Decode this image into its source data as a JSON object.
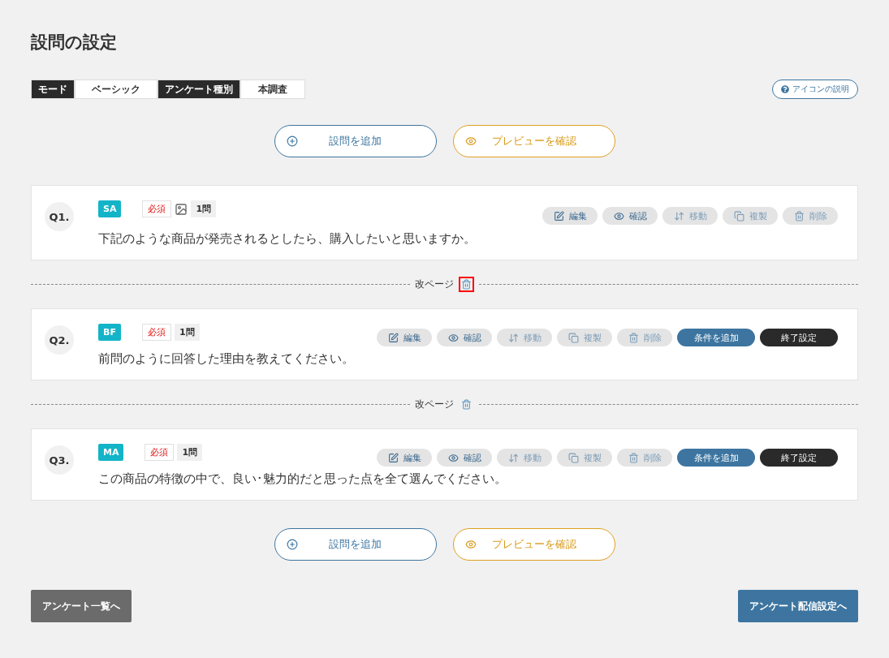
{
  "title": "設問の設定",
  "settings": [
    {
      "label": "モード",
      "value": "ベーシック"
    },
    {
      "label": "アンケート種別",
      "value": "本調査"
    }
  ],
  "help_button": "アイコンの説明",
  "top_actions": [
    {
      "kind": "add",
      "label": "設問を追加"
    },
    {
      "kind": "preview",
      "label": "プレビューを確認"
    }
  ],
  "items": [
    {
      "kind": "question",
      "number": "Q1.",
      "type": "SA",
      "required": "必須",
      "has_image": true,
      "count": "1問",
      "text": "下記のような商品が発売されるとしたら、購入したいと思いますか。",
      "actions": [
        {
          "kind": "edit",
          "label": "編集",
          "disabled": false
        },
        {
          "kind": "view",
          "label": "確認",
          "disabled": false
        },
        {
          "kind": "move",
          "label": "移動",
          "disabled": true
        },
        {
          "kind": "copy",
          "label": "複製",
          "disabled": true
        },
        {
          "kind": "delete",
          "label": "削除",
          "disabled": true
        }
      ]
    },
    {
      "kind": "page_break",
      "label": "改ページ",
      "highlighted": true
    },
    {
      "kind": "question",
      "number": "Q2.",
      "type": "BF",
      "required": "必須",
      "has_image": false,
      "count": "1問",
      "text": "前問のように回答した理由を教えてください。",
      "actions": [
        {
          "kind": "edit",
          "label": "編集",
          "disabled": false
        },
        {
          "kind": "view",
          "label": "確認",
          "disabled": false
        },
        {
          "kind": "move",
          "label": "移動",
          "disabled": true
        },
        {
          "kind": "copy",
          "label": "複製",
          "disabled": true
        },
        {
          "kind": "delete",
          "label": "削除",
          "disabled": true
        },
        {
          "kind": "condition",
          "label": "条件を追加",
          "disabled": false
        },
        {
          "kind": "end",
          "label": "終了設定",
          "disabled": false
        }
      ]
    },
    {
      "kind": "page_break",
      "label": "改ページ",
      "highlighted": false
    },
    {
      "kind": "question",
      "number": "Q3.",
      "type": "MA",
      "required": "必須",
      "has_image": false,
      "count": "1問",
      "text": "この商品の特徴の中で、良い･魅力的だと思った点を全て選んでください。",
      "actions": [
        {
          "kind": "edit",
          "label": "編集",
          "disabled": false
        },
        {
          "kind": "view",
          "label": "確認",
          "disabled": false
        },
        {
          "kind": "move",
          "label": "移動",
          "disabled": true
        },
        {
          "kind": "copy",
          "label": "複製",
          "disabled": true
        },
        {
          "kind": "delete",
          "label": "削除",
          "disabled": true
        },
        {
          "kind": "condition",
          "label": "条件を追加",
          "disabled": false
        },
        {
          "kind": "end",
          "label": "終了設定",
          "disabled": false
        }
      ]
    }
  ],
  "bottom_actions": [
    {
      "kind": "add",
      "label": "設問を追加"
    },
    {
      "kind": "preview",
      "label": "プレビューを確認"
    }
  ],
  "footer": [
    {
      "kind": "back",
      "label": "アンケート一覧へ"
    },
    {
      "kind": "next",
      "label": "アンケート配信設定へ"
    }
  ]
}
